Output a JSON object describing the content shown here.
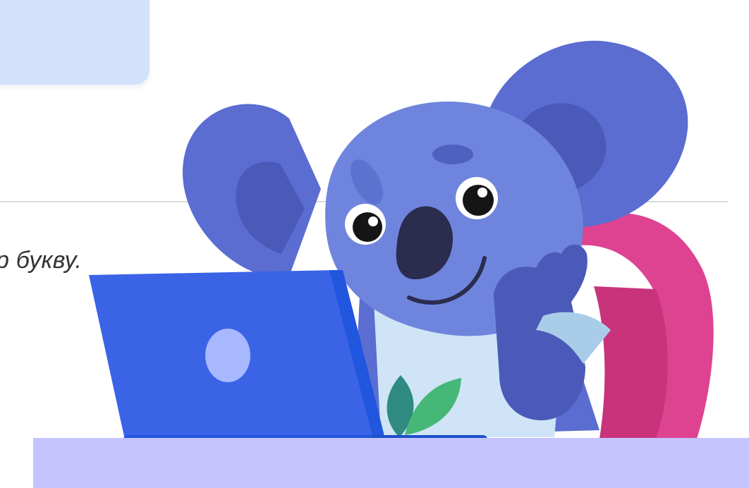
{
  "content": {
    "partial_text": "р букву."
  },
  "illustration": {
    "subject": "koala-at-laptop",
    "colors": {
      "koala_body": "#5b6dd1",
      "koala_face": "#6f84dd",
      "koala_ear_inner": "#4b5ab8",
      "koala_nose": "#2b2c4e",
      "chair": "#de4392",
      "chair_shadow": "#c9337c",
      "laptop": "#3a63e6",
      "laptop_dark": "#2156df",
      "laptop_logo": "#a7b8ff",
      "desk": "#c5c4ff",
      "shirt": "#cfe4f6",
      "leaf_dark": "#2f8a82",
      "leaf_light": "#45b878"
    }
  }
}
